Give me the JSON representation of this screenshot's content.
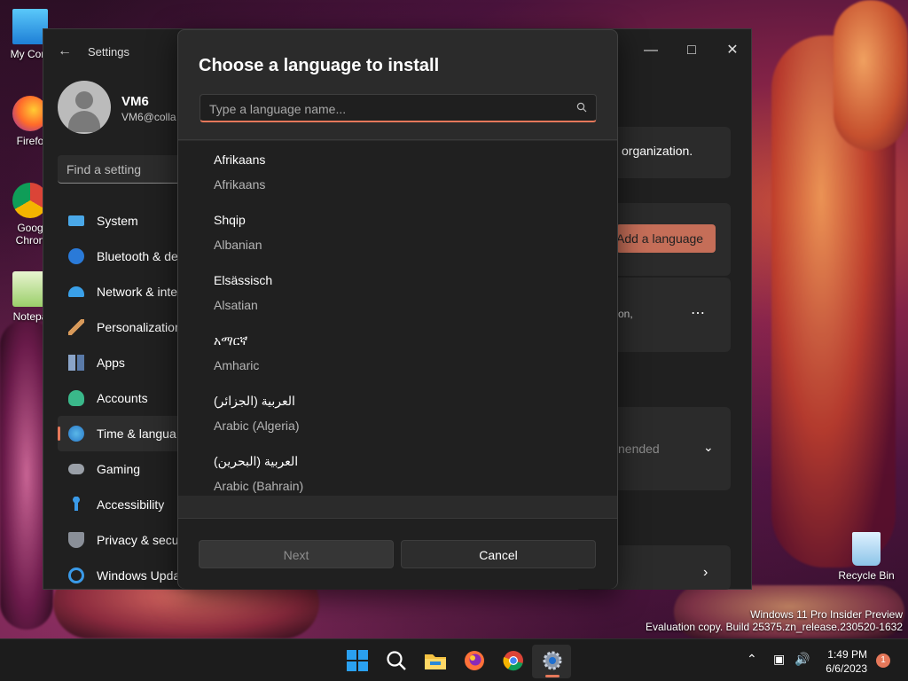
{
  "desktop": {
    "icons": [
      {
        "label": "My Com",
        "icon": "computer-icon"
      },
      {
        "label": "Firefo",
        "icon": "firefox-icon"
      },
      {
        "label": "Goog",
        "label2": "Chron",
        "icon": "chrome-icon"
      },
      {
        "label": "Notepa",
        "icon": "notepad-icon"
      },
      {
        "label": "Recycle Bin",
        "icon": "recycle-bin-icon"
      }
    ],
    "watermark": {
      "line1": "Windows 11 Pro Insider Preview",
      "line2": "Evaluation copy. Build 25375.zn_release.230520-1632"
    }
  },
  "settings": {
    "app_title": "Settings",
    "profile": {
      "name": "VM6",
      "email": "VM6@colla"
    },
    "search_placeholder": "Find a setting",
    "nav": [
      {
        "label": "System",
        "icon": "system-icon"
      },
      {
        "label": "Bluetooth & de",
        "icon": "bluetooth-icon"
      },
      {
        "label": "Network & inte",
        "icon": "network-icon"
      },
      {
        "label": "Personalization",
        "icon": "brush-icon"
      },
      {
        "label": "Apps",
        "icon": "apps-icon"
      },
      {
        "label": "Accounts",
        "icon": "accounts-icon"
      },
      {
        "label": "Time & langua",
        "icon": "time-language-icon",
        "active": true
      },
      {
        "label": "Gaming",
        "icon": "gaming-icon"
      },
      {
        "label": "Accessibility",
        "icon": "accessibility-icon"
      },
      {
        "label": "Privacy & secu",
        "icon": "shield-icon"
      },
      {
        "label": "Windows Upda",
        "icon": "update-icon"
      }
    ],
    "content": {
      "org_text": "organization.",
      "add_language": "Add a language",
      "fragment_on": "on,",
      "fragment_recommended": "nended",
      "more_options": "⋯"
    }
  },
  "dialog": {
    "title": "Choose a language to install",
    "search_placeholder": "Type a language name...",
    "languages": [
      {
        "native": "Afrikaans",
        "english": "Afrikaans"
      },
      {
        "native": "Shqip",
        "english": "Albanian"
      },
      {
        "native": "Elsässisch",
        "english": "Alsatian"
      },
      {
        "native": "አማርኛ",
        "english": "Amharic"
      },
      {
        "native": "العربية (الجزائر)",
        "english": "Arabic (Algeria)"
      },
      {
        "native": "العربية (البحرين)",
        "english": "Arabic (Bahrain)"
      }
    ],
    "next_label": "Next",
    "cancel_label": "Cancel"
  },
  "taskbar": {
    "apps": [
      "start-icon",
      "search-icon",
      "file-explorer-icon",
      "firefox-icon",
      "chrome-icon",
      "settings-icon"
    ],
    "time": "1:49 PM",
    "date": "6/6/2023",
    "notifications": "1"
  },
  "colors": {
    "accent": "#e6785a",
    "dialog_bg": "#2b2b2b",
    "window_bg": "#202020"
  }
}
